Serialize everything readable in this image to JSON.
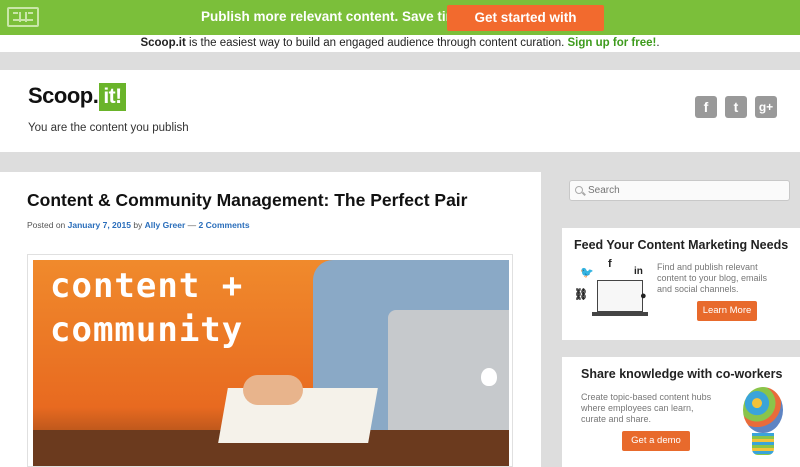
{
  "promo": {
    "message": "Publish more relevant content. Save time.",
    "cta": "Get started with Scoop.it"
  },
  "tagline": {
    "brand": "Scoop.it",
    "text": " is the easiest way to build an engaged audience through content curation. ",
    "signup": "Sign up for free!",
    "end": "."
  },
  "header": {
    "logo_main": "Scoop.",
    "logo_it": "it!",
    "description": "You are the content you publish",
    "social": {
      "facebook": "f",
      "twitter": "t",
      "google": "g+"
    }
  },
  "post": {
    "title": "Content & Community Management: The Perfect Pair",
    "posted_on": "Posted on ",
    "date": "January 7, 2015",
    "by": " by ",
    "author": "Ally Greer",
    "sep": " — ",
    "comments": "2 Comments",
    "image_line1": "content +",
    "image_line2": "community"
  },
  "sidebar": {
    "search_placeholder": "Search",
    "widget1": {
      "title": "Feed Your Content Marketing Needs",
      "text": "Find and publish relevant content to your blog, emails and social channels.",
      "button": "Learn More"
    },
    "widget2": {
      "title": "Share knowledge with co-workers",
      "text": "Create topic-based content hubs where employees can learn, curate and share.",
      "button": "Get a demo"
    }
  },
  "colors": {
    "promo_green": "#7bbf3a",
    "cta_orange": "#f26a2e",
    "link_blue": "#2a6ebb",
    "button_orange": "#e86a2c"
  }
}
